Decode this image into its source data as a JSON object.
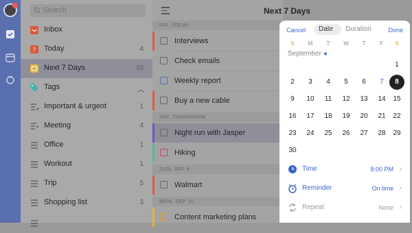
{
  "header": {
    "title": "Next 7 Days"
  },
  "search": {
    "placeholder": "Search"
  },
  "sidebar": {
    "items": [
      {
        "label": "Inbox",
        "count": ""
      },
      {
        "label": "Today",
        "count": "4"
      },
      {
        "label": "Next 7 Days",
        "count": "10"
      },
      {
        "label": "Tags",
        "count": ""
      },
      {
        "label": "Important & urgent",
        "count": "1"
      },
      {
        "label": "Meeting",
        "count": "4"
      },
      {
        "label": "Office",
        "count": "1"
      },
      {
        "label": "Workout",
        "count": "1"
      },
      {
        "label": "Trip",
        "count": "5"
      },
      {
        "label": "Shopping list",
        "count": "3"
      }
    ]
  },
  "tasks": {
    "groups": [
      {
        "heading": "FRI, TODAY"
      },
      {
        "heading": "SAT, TOMORROW"
      },
      {
        "heading": "SUN, SEP 9"
      },
      {
        "heading": "MON, SEP 10"
      }
    ],
    "items": [
      {
        "label": "Interviews"
      },
      {
        "label": "Check emails"
      },
      {
        "label": "Weekly report"
      },
      {
        "label": "Buy a new cable"
      },
      {
        "label": "Night run with Jasper"
      },
      {
        "label": "Hiking"
      },
      {
        "label": "Walmart"
      },
      {
        "label": "Content marketing plans"
      }
    ]
  },
  "picker": {
    "cancel": "Cancel",
    "done": "Done",
    "tab_date": "Date",
    "tab_duration": "Duration",
    "weekdays": [
      "S",
      "M",
      "T",
      "W",
      "T",
      "F",
      "S"
    ],
    "month": "September",
    "month_arrow": "◂",
    "days": [
      "1",
      "2",
      "3",
      "4",
      "5",
      "6",
      "7",
      "8",
      "9",
      "10",
      "11",
      "12",
      "13",
      "14",
      "15",
      "16",
      "17",
      "18",
      "19",
      "20",
      "21",
      "22",
      "23",
      "24",
      "25",
      "26",
      "27",
      "28",
      "29",
      "30"
    ],
    "selected_day": "8",
    "today_day": "7",
    "options": {
      "time_label": "Time",
      "time_value": "8:00 PM",
      "reminder_label": "Reminder",
      "reminder_value": "On time",
      "repeat_label": "Repeat",
      "repeat_value": "None"
    }
  },
  "colors": {
    "accent": "#3a66c9",
    "weekend": "#d9a21e",
    "rail": "#5a6fb0",
    "bar_purple": "#6a55c9",
    "bar_red": "#e05a47",
    "bar_yellow": "#e4b43a",
    "bar_teal": "#54b8a4"
  }
}
